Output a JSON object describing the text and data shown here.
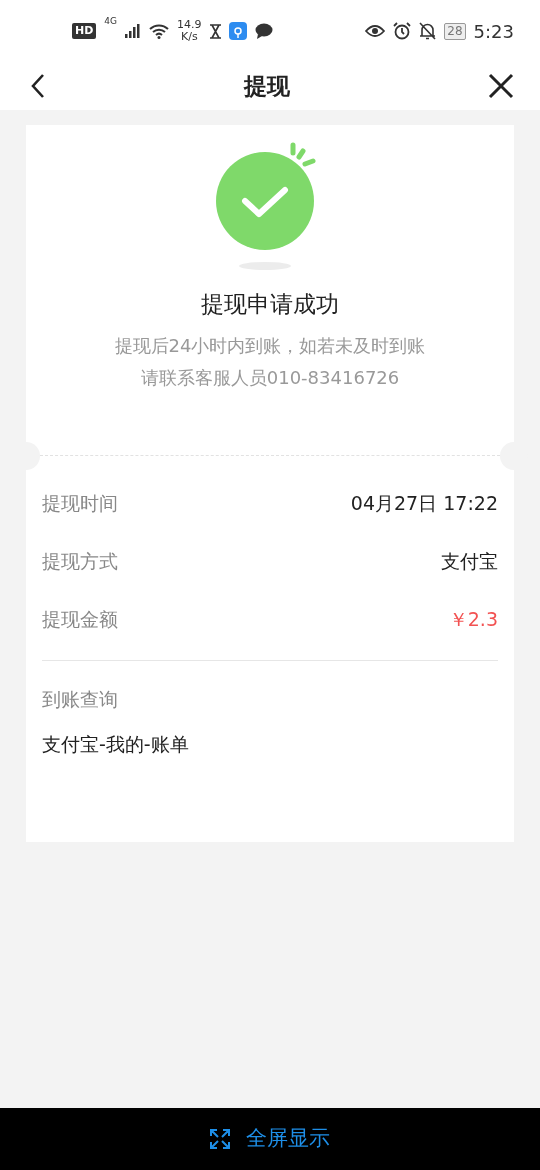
{
  "status_bar": {
    "network_badge": "HD",
    "network_type": "4G",
    "speed_value": "14.9",
    "speed_unit": "K/s",
    "battery": "28",
    "time": "5:23"
  },
  "header": {
    "title": "提现"
  },
  "result": {
    "title": "提现申请成功",
    "message_lines": [
      "提现后24小时内到账，如若未及时到账",
      "请联系客服人员010-83416726"
    ]
  },
  "details": [
    {
      "label": "提现时间",
      "value": "04月27日 17:22",
      "kind": "plain"
    },
    {
      "label": "提现方式",
      "value": "支付宝",
      "kind": "plain"
    },
    {
      "label": "提现金额",
      "value": "￥2.3",
      "kind": "amount"
    }
  ],
  "query": {
    "label": "到账查询",
    "value": "支付宝-我的-账单"
  },
  "bottom_bar": {
    "label": "全屏显示"
  }
}
